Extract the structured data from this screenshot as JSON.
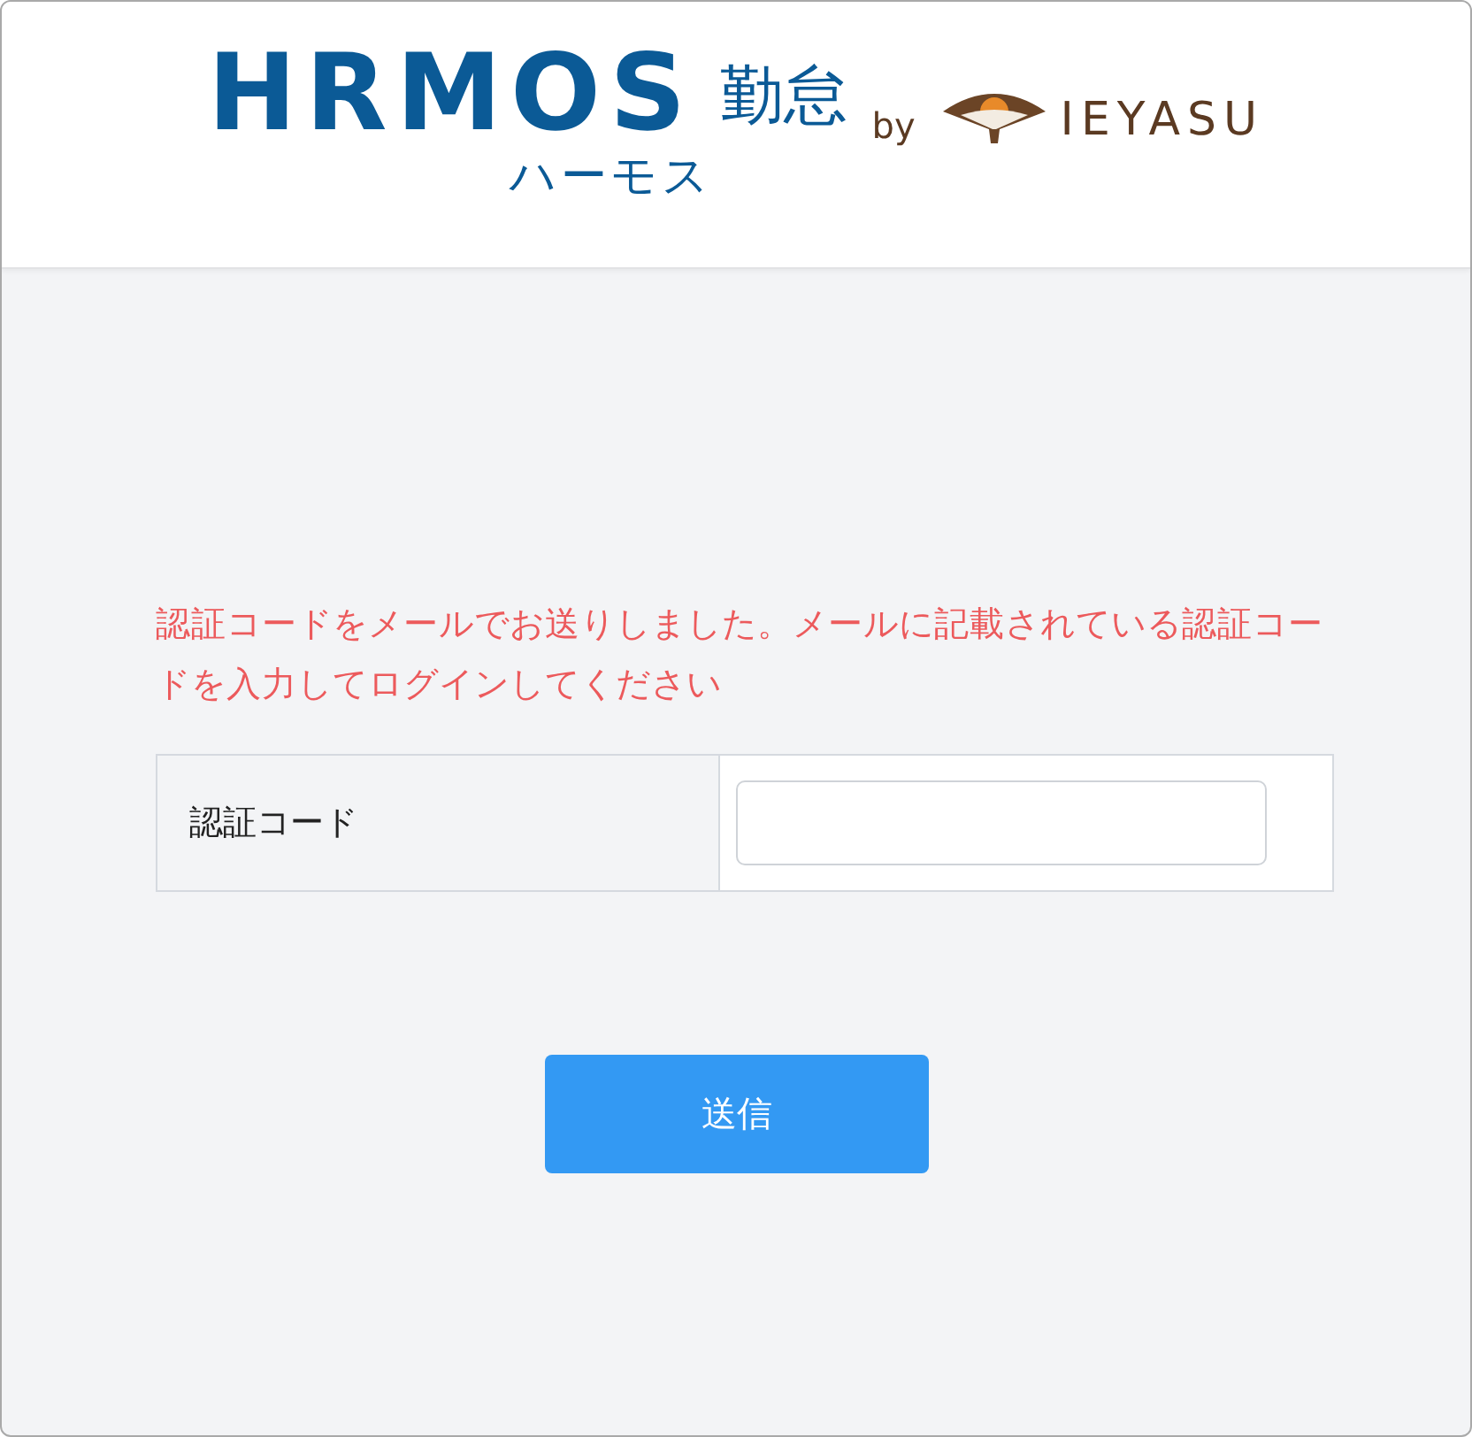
{
  "header": {
    "logo": {
      "wordmark": "HRMOS",
      "product": "勤怠",
      "reading": "ハーモス",
      "by": "by",
      "partner": "IEYASU"
    }
  },
  "message": "認証コードをメールでお送りしました。メールに記載されている認証コードを入力してログインしてください",
  "form": {
    "rows": [
      {
        "label": "認証コード",
        "kind": "text"
      }
    ]
  },
  "submit": {
    "label": "送信"
  }
}
